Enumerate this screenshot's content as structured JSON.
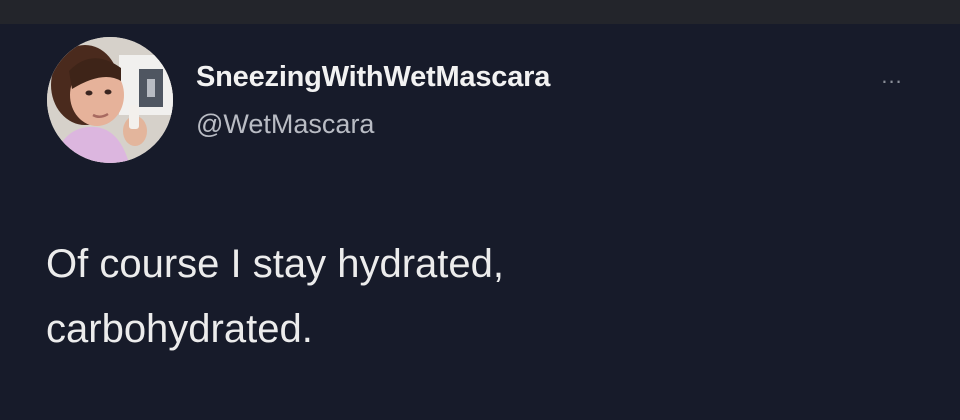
{
  "tweet": {
    "display_name": "SneezingWithWetMascara",
    "handle": "@WetMascara",
    "more_label": "...",
    "text_lines": [
      "Of course I stay hydrated,",
      "carbohydrated."
    ],
    "avatar_icon": "profile-photo-icon"
  },
  "colors": {
    "background": "#171b2a",
    "name": "#f2f2f2",
    "handle": "#b9bcc4",
    "text": "#ececec"
  }
}
